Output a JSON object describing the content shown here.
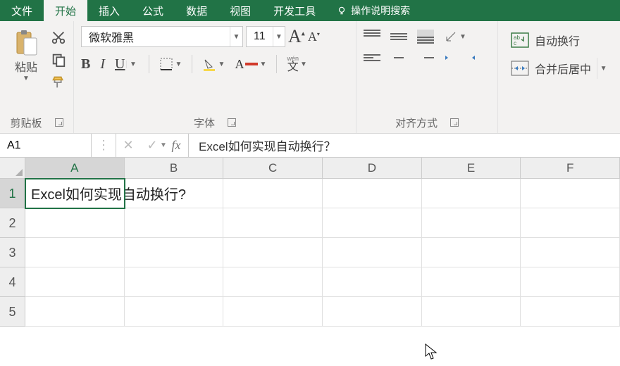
{
  "menu": {
    "tabs": [
      "文件",
      "开始",
      "插入",
      "公式",
      "数据",
      "视图",
      "开发工具"
    ],
    "active_index": 1,
    "help": "操作说明搜索"
  },
  "ribbon": {
    "clipboard": {
      "paste": "粘贴",
      "group_label": "剪贴板"
    },
    "font": {
      "name": "微软雅黑",
      "size": "11",
      "wen_label": "wén",
      "group_label": "字体"
    },
    "alignment": {
      "group_label": "对齐方式"
    },
    "wrap": {
      "wrap_text": "自动换行",
      "merge_center": "合并后居中"
    }
  },
  "formula_bar": {
    "name_box": "A1",
    "fx": "fx",
    "formula": "Excel如何实现自动换行？"
  },
  "grid": {
    "columns": [
      "A",
      "B",
      "C",
      "D",
      "E",
      "F"
    ],
    "rows": [
      "1",
      "2",
      "3",
      "4",
      "5"
    ],
    "active": "A1",
    "cells": {
      "A1": "Excel如何实现自动换行?"
    }
  }
}
